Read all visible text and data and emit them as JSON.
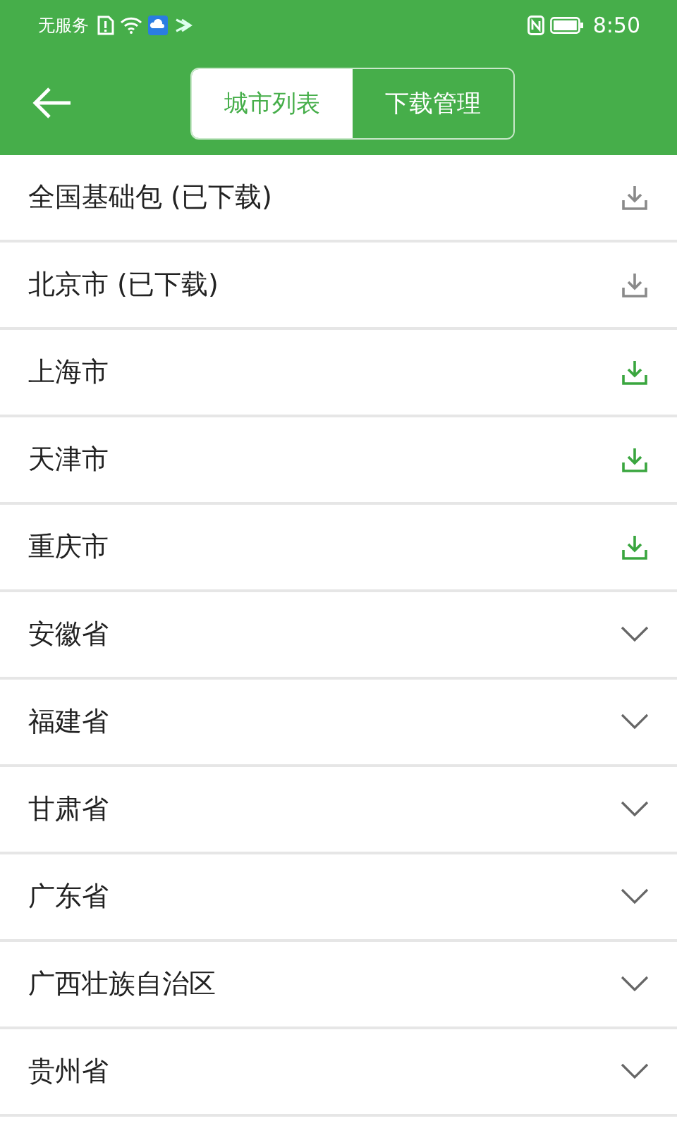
{
  "status_bar": {
    "carrier": "无服务",
    "time": "8:50"
  },
  "tabs": [
    {
      "label": "城市列表",
      "selected": true
    },
    {
      "label": "下载管理",
      "selected": false
    }
  ],
  "items": [
    {
      "kind": "download",
      "name": "全国基础包 (已下载)",
      "downloaded": true
    },
    {
      "kind": "download",
      "name": "北京市 (已下载)",
      "downloaded": true
    },
    {
      "kind": "download",
      "name": "上海市",
      "downloaded": false
    },
    {
      "kind": "download",
      "name": "天津市",
      "downloaded": false
    },
    {
      "kind": "download",
      "name": "重庆市",
      "downloaded": false
    },
    {
      "kind": "province",
      "name": "安徽省"
    },
    {
      "kind": "province",
      "name": "福建省"
    },
    {
      "kind": "province",
      "name": "甘肃省"
    },
    {
      "kind": "province",
      "name": "广东省"
    },
    {
      "kind": "province",
      "name": "广西壮族自治区"
    },
    {
      "kind": "province",
      "name": "贵州省"
    }
  ]
}
